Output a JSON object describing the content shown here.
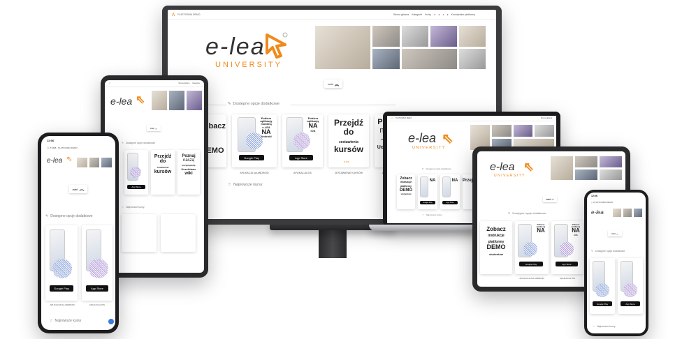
{
  "brand": {
    "wordmark": "e-lea",
    "subtitle": "UNIVERSITY",
    "small_label": "e-lea",
    "accent_color": "#f08a1c",
    "text_color": "#333333"
  },
  "platform_label": "PLATFORMA DEMO",
  "nav": {
    "items": [
      "Strona główna",
      "Kategorie",
      "Kursy"
    ],
    "user": "Koordynator platformy"
  },
  "hide_button": "zwiń",
  "sections": {
    "options": "Dostępne opcje dodatkowe",
    "newest": "Najnowsze kursy"
  },
  "cards": {
    "demo": {
      "line1": "Zobacz",
      "line2": "instrukcje",
      "line3": "platformy",
      "line4": "DEMO",
      "line5": "studentów"
    },
    "android": {
      "line1": "Pobierz",
      "line2": "aplikację",
      "line3": "mobilną",
      "line4": "e-LEA",
      "line5": "NA",
      "line6": "Android",
      "store": "Google Play",
      "caption": "APLIKACJA NA ANDROID"
    },
    "ios": {
      "line1": "Pobierz",
      "line2": "aplikację",
      "line3": "NA",
      "line4": "iOS",
      "store": "App Store",
      "caption": "APLIKACJA IOS"
    },
    "przejdz": {
      "line1": "Przejdź",
      "line2": "do",
      "line3": "zestawienia",
      "line4": "kursów",
      "caption": "ZESTAWIENIE KURSÓW"
    },
    "poznaj": {
      "line1": "Poznaj",
      "line2": "naszą",
      "line3": "encyklopedię",
      "line4": "Uczelniane",
      "line5": "wiki",
      "caption": "ZOBACZ WIKI"
    }
  },
  "phone_left": {
    "time": "12:06"
  },
  "phone_right": {
    "time": "12:06"
  },
  "colors": {
    "bezel": "#2a2a2c",
    "stand": "#3a3a3c",
    "qr_blue": "#8aa2d8",
    "qr_purple": "#b39ad8"
  },
  "icons": [
    "hide-chevron-icon",
    "puzzle-icon",
    "star-icon",
    "chat-icon"
  ]
}
